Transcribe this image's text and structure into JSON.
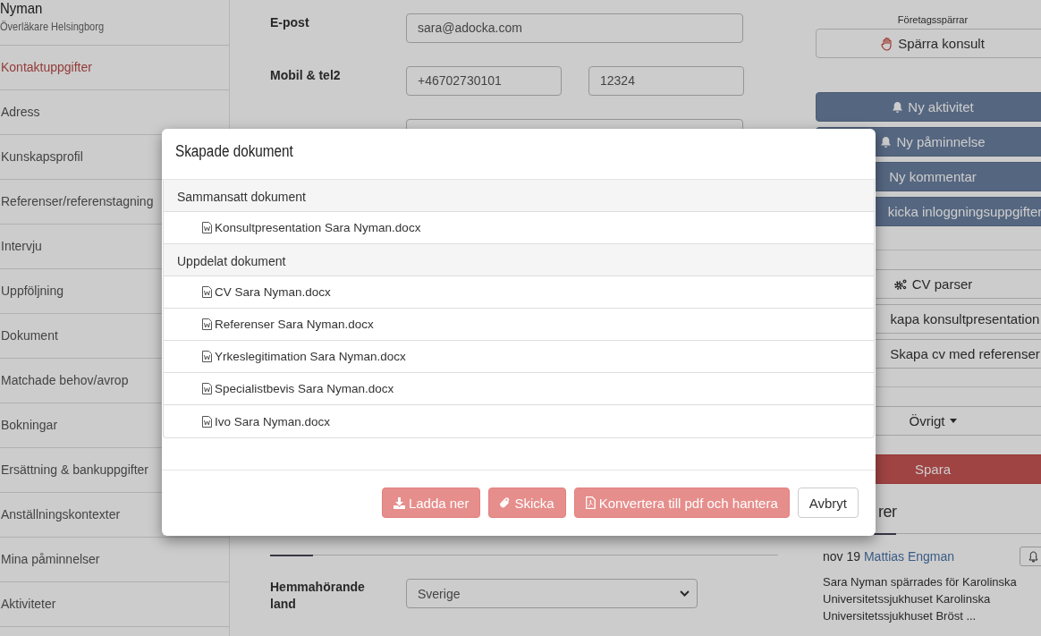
{
  "sidebar": {
    "name": "Nyman",
    "subtitle": "Överläkare Helsingborg",
    "items": [
      {
        "label": "Kontaktuppgifter",
        "selected": true
      },
      {
        "label": "Adress",
        "selected": false
      },
      {
        "label": "Kunskapsprofil",
        "selected": false
      },
      {
        "label": "Referenser/referenstagning",
        "selected": false
      },
      {
        "label": "Intervju",
        "selected": false
      },
      {
        "label": "Uppföljning",
        "selected": false
      },
      {
        "label": "Dokument",
        "selected": false
      },
      {
        "label": "Matchade behov/avrop",
        "selected": false
      },
      {
        "label": "Bokningar",
        "selected": false
      },
      {
        "label": "Ersättning & bankuppgifter",
        "selected": false
      },
      {
        "label": "Anställningskontexter",
        "selected": false
      },
      {
        "label": "Mina påminnelser",
        "selected": false
      },
      {
        "label": "Aktiviteter",
        "selected": false
      }
    ]
  },
  "form": {
    "fields": [
      {
        "label": "E-post",
        "kind": "text",
        "values": [
          "sara@adocka.com"
        ]
      },
      {
        "label": "Mobil & tel2",
        "kind": "pair",
        "values": [
          "+46702730101",
          "12324"
        ]
      },
      {
        "kind": "blank"
      }
    ],
    "home_country": {
      "label": "Hemmahörande land",
      "value": "Sverige"
    }
  },
  "actions": {
    "block_label": "Företagsspärrar",
    "buttons": [
      {
        "label": "Spärra konsult",
        "kind": "block"
      },
      {
        "label": "Ny aktivitet",
        "kind": "bell"
      },
      {
        "label": "Ny påminnelse",
        "kind": "bell"
      },
      {
        "label": "Ny kommentar",
        "kind": "primary"
      },
      {
        "label": "kicka inloggningsuppgifter",
        "kind": "primary-covered"
      },
      {
        "label": "CV parser",
        "kind": "gears"
      },
      {
        "label": "kapa konsultpresentation",
        "kind": "default-covered"
      },
      {
        "label": "Skapa cv med referenser",
        "kind": "default-covered"
      },
      {
        "label": "Övrigt",
        "kind": "dropdown"
      },
      {
        "label": "Spara",
        "kind": "save"
      }
    ]
  },
  "comments": {
    "heading": "rer",
    "items": [
      {
        "date": "nov 19",
        "author": "Mattias Engman",
        "text": "Sara Nyman spärrades för Karolinska Universitetssjukhuset Karolinska Universitetssjukhuset Bröst ..."
      }
    ]
  },
  "modal": {
    "title": "Skapade dokument",
    "groups": [
      {
        "title": "Sammansatt dokument",
        "files": [
          "Konsultpresentation Sara Nyman.docx"
        ]
      },
      {
        "title": "Uppdelat dokument",
        "files": [
          "CV Sara Nyman.docx",
          "Referenser Sara Nyman.docx",
          "Yrkeslegitimation Sara Nyman.docx",
          "Specialistbevis Sara Nyman.docx",
          "Ivo Sara Nyman.docx"
        ]
      }
    ],
    "buttons": [
      {
        "label": "Ladda ner",
        "kind": "download",
        "disabled": true
      },
      {
        "label": "Skicka",
        "kind": "attach",
        "disabled": true
      },
      {
        "label": "Konvertera till pdf och hantera",
        "kind": "pdf",
        "disabled": true
      },
      {
        "label": "Avbryt",
        "kind": "cancel",
        "disabled": false
      }
    ]
  }
}
